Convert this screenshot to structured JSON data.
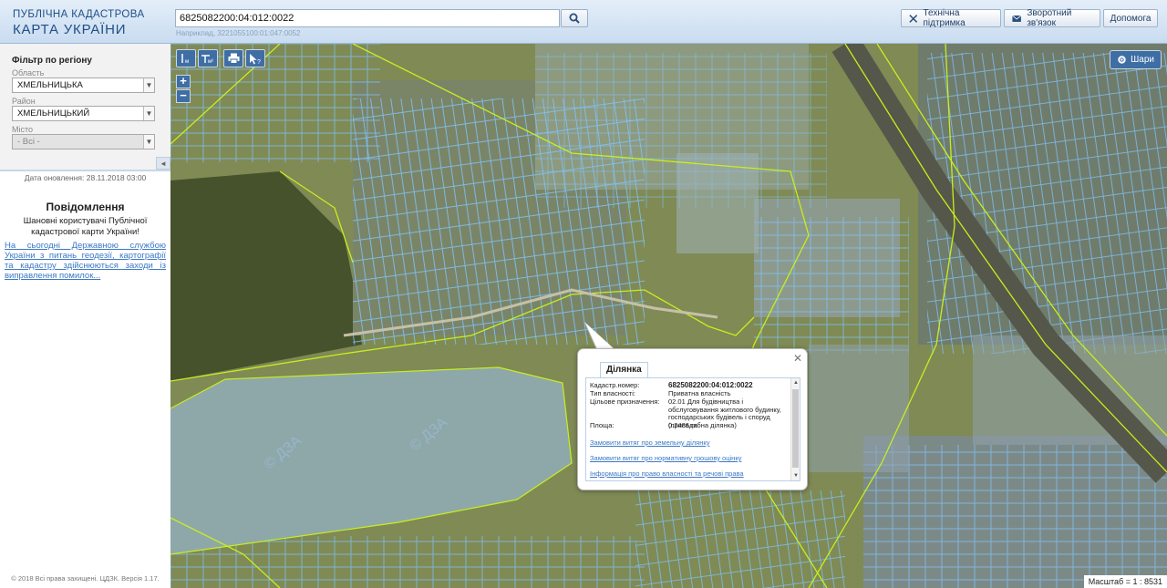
{
  "header": {
    "logo_line1": "ПУБЛІЧНА КАДАСТРОВА",
    "logo_line2": "КАРТА УКРАЇНИ",
    "search_value": "6825082200:04:012:0022",
    "search_example": "Наприклад, 3221055100:01:047:0052",
    "buttons": {
      "support": "Технічна підтримка",
      "feedback": "Зворотний зв'язок",
      "help": "Допомога"
    }
  },
  "sidebar": {
    "filter_title": "Фільтр по регіону",
    "oblast_label": "Область",
    "oblast_value": "ХМЕЛЬНИЦЬКА",
    "rayon_label": "Район",
    "rayon_value": "ХМЕЛЬНИЦЬКИЙ",
    "misto_label": "Місто",
    "misto_value": "- Всі -",
    "update_date": "Дата оновлення: 28.11.2018 03:00",
    "notice_title": "Повідомлення",
    "notice_text": "Шановні користувачі Публічної кадастрової карти України!",
    "notice_link": "На сьогодні Державною службою України з питань геодезії, картографії та кадастру здійснюються заходи із виправлення помилок...",
    "copyright": "© 2018 Всі права захищені. ЦДЗК. Версія 1.17."
  },
  "map": {
    "layers_label": "Шари",
    "scale_label": "Масштаб = 1 : 8531",
    "watermark": "© ДЗА",
    "colors": {
      "parcel": "#7fc4ff",
      "boundary": "#c8ee1c",
      "water": "#8fa9ac"
    }
  },
  "popup": {
    "tab": "Ділянка",
    "fields": [
      {
        "key": "Кадастр.номер:",
        "value": "6825082200:04:012:0022"
      },
      {
        "key": "Тип власності:",
        "value": "Приватна власність"
      },
      {
        "key": "Цільове призначення:",
        "value": "02.01 Для будівництва і обслуговування житлового будинку, господарських будівель і споруд (присадибна ділянка)"
      },
      {
        "key": "Площа:",
        "value": "0.2486 га"
      }
    ],
    "links": [
      "Замовити витяг про земельну ділянку",
      "Замовити витяг про нормативну грошову оцінку",
      "Інформація про право власності та речові права"
    ]
  }
}
